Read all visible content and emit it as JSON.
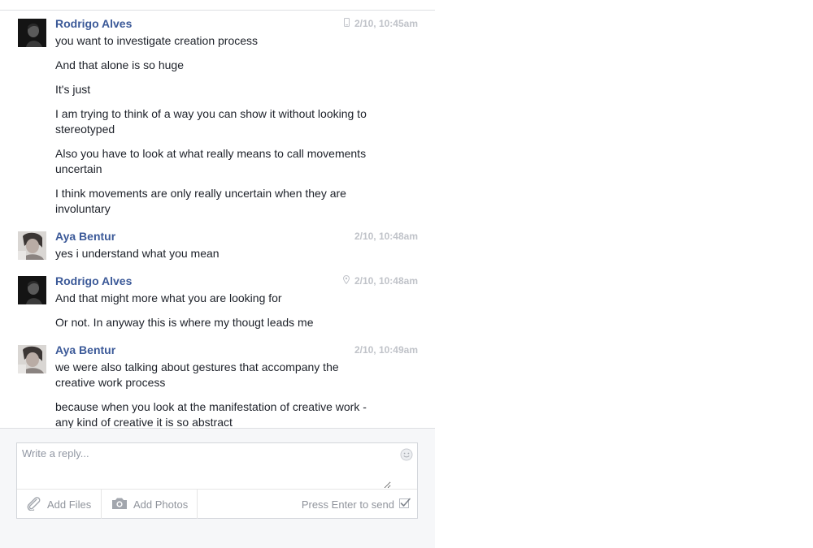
{
  "composer": {
    "placeholder": "Write a reply...",
    "add_files": "Add Files",
    "add_photos": "Add Photos",
    "press_enter": "Press Enter to send",
    "press_enter_checked": true
  },
  "messages": [
    {
      "sender": "Rodrigo Alves",
      "time": "2/10, 10:45am",
      "meta_icon": "mobile-icon",
      "avatar": "rodrigo-avatar",
      "lines": [
        "you want to investigate creation process",
        "And that alone is so huge",
        "It's just",
        "I am trying to think of a way you can show it without looking to stereotyped",
        "Also you have to look at what really means to call movements uncertain",
        "I think movements are only really uncertain when they are involuntary"
      ]
    },
    {
      "sender": "Aya Bentur",
      "time": "2/10, 10:48am",
      "meta_icon": "",
      "avatar": "aya-avatar",
      "lines": [
        "yes i understand what you mean"
      ]
    },
    {
      "sender": "Rodrigo Alves",
      "time": "2/10, 10:48am",
      "meta_icon": "location-pin-icon",
      "avatar": "rodrigo-avatar",
      "lines": [
        "And that might more what you are looking for",
        "Or not. In anyway this is where my thougt leads me"
      ]
    },
    {
      "sender": "Aya Bentur",
      "time": "2/10, 10:49am",
      "meta_icon": "",
      "avatar": "aya-avatar",
      "lines": [
        "we were also talking about gestures that accompany the creative work process",
        "because when you look at the manifestation of creative work - any kind of creative it is so abstract"
      ]
    }
  ]
}
